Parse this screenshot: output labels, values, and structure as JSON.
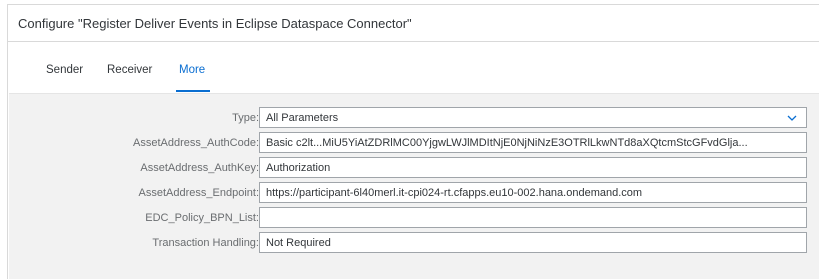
{
  "dialog": {
    "title": "Configure \"Register Deliver Events in Eclipse Dataspace Connector\""
  },
  "tabs": [
    {
      "label": "Sender"
    },
    {
      "label": "Receiver"
    },
    {
      "label": "More"
    }
  ],
  "active_tab": "More",
  "fields": {
    "type": {
      "label": "Type:",
      "value": "All Parameters"
    },
    "auth_code": {
      "label": "AssetAddress_AuthCode:",
      "value": "Basic c2lt...MiU5YiAtZDRlMC00YjgwLWJlMDItNjE0NjNiNzE3OTRlLkwNTd8aXQtcmStcGFvdGlja..."
    },
    "auth_key": {
      "label": "AssetAddress_AuthKey:",
      "value": "Authorization"
    },
    "endpoint": {
      "label": "AssetAddress_Endpoint:",
      "value": "https://participant-6l40merl.it-cpi024-rt.cfapps.eu10-002.hana.ondemand.com"
    },
    "bpn_list": {
      "label": "EDC_Policy_BPN_List:",
      "value": ""
    },
    "transaction_handling": {
      "label": "Transaction Handling:",
      "value": "Not Required"
    }
  },
  "icons": {
    "type_dropdown": "chevron-down-icon"
  },
  "colors": {
    "accent": "#0a6ed1",
    "content_bg": "#f2f2f2"
  }
}
